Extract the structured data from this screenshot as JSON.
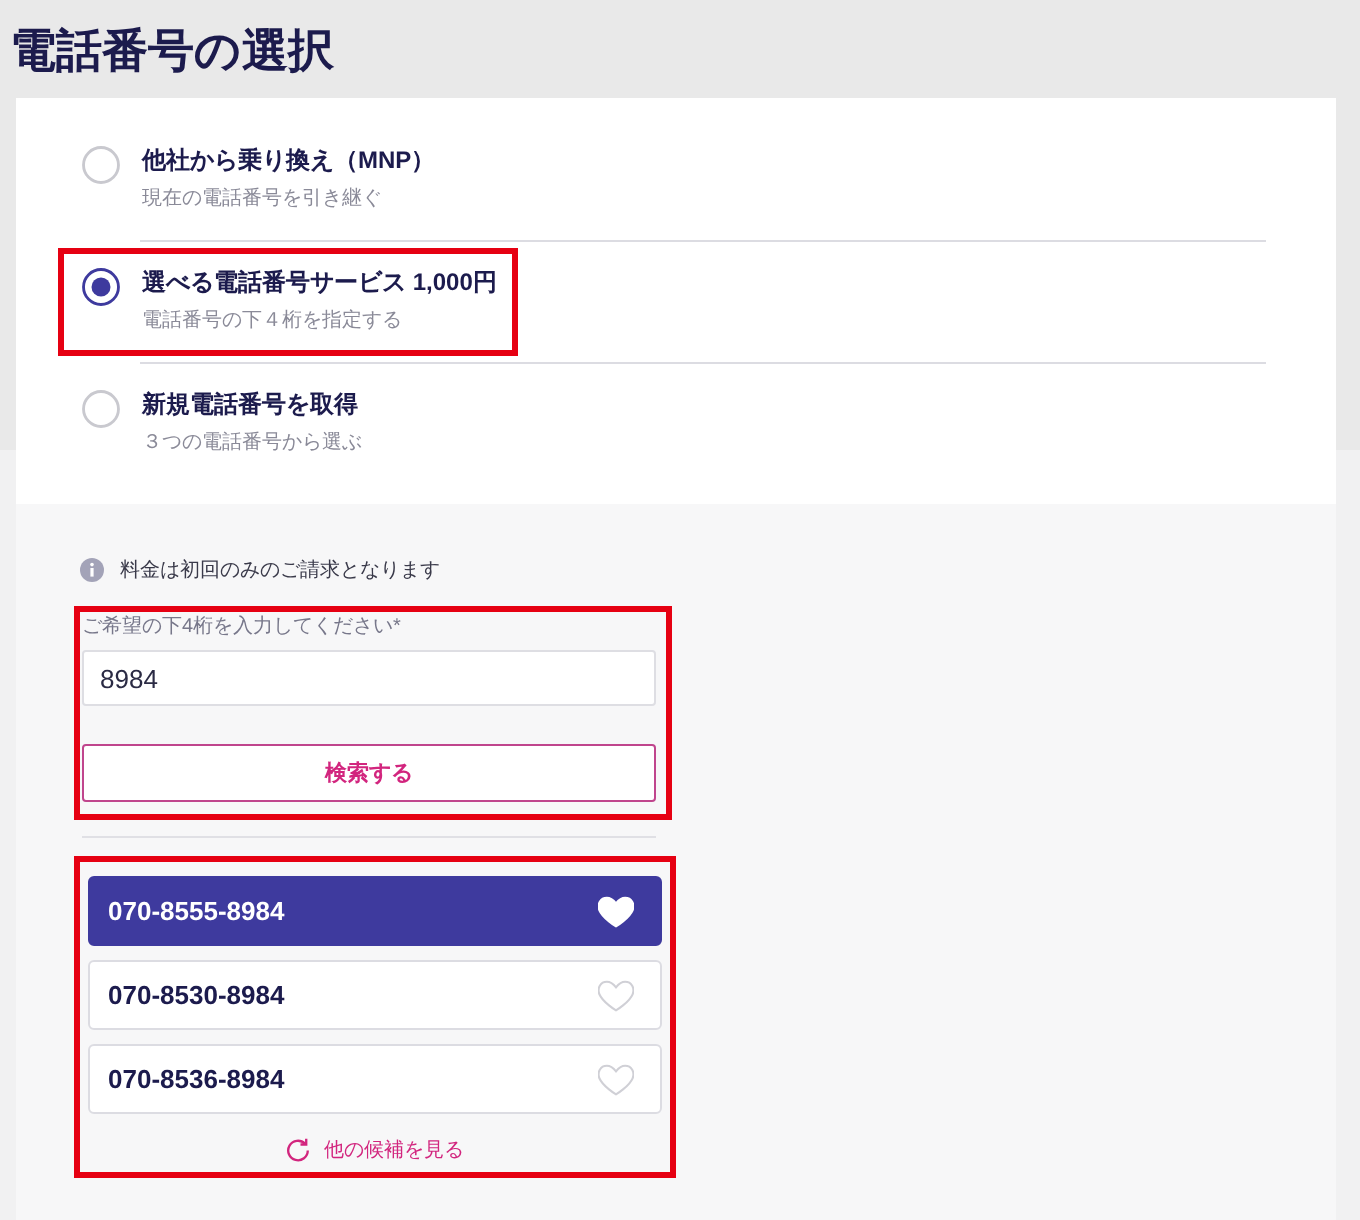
{
  "title": "電話番号の選択",
  "options": [
    {
      "label": "他社から乗り換え（MNP）",
      "description": "現在の電話番号を引き継ぐ",
      "selected": false,
      "highlighted": false
    },
    {
      "label": "選べる電話番号サービス 1,000円",
      "description": "電話番号の下４桁を指定する",
      "selected": true,
      "highlighted": true
    },
    {
      "label": "新規電話番号を取得",
      "description": "３つの電話番号から選ぶ",
      "selected": false,
      "highlighted": false
    }
  ],
  "notice": {
    "text": "料金は初回のみのご請求となります"
  },
  "search": {
    "label": "ご希望の下4桁を入力してください*",
    "value": "8984",
    "button": "検索する",
    "highlighted": true
  },
  "candidates": {
    "highlighted": true,
    "numbers": [
      {
        "number": "070-8555-8984",
        "selected": true
      },
      {
        "number": "070-8530-8984",
        "selected": false
      },
      {
        "number": "070-8536-8984",
        "selected": false
      }
    ],
    "more_link": "他の候補を見る"
  }
}
